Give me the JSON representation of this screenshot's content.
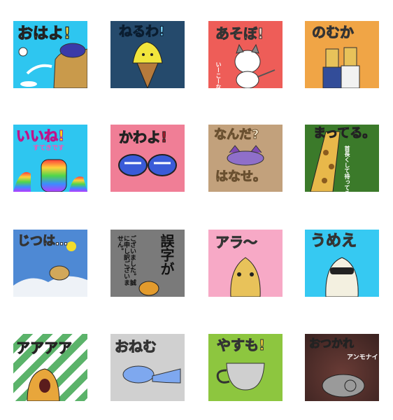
{
  "stickers": [
    {
      "id": "ohayo",
      "caption": "おはよ!",
      "extra": "♪",
      "bg": "#2ec6f0"
    },
    {
      "id": "neruwa",
      "caption": "ねるわ!",
      "extra": "",
      "bg": "#254a6c"
    },
    {
      "id": "asobo",
      "caption": "あそぼ!",
      "extra": "いーこーな",
      "bg": "#ee5d58"
    },
    {
      "id": "noseru",
      "caption": "のむか",
      "extra": "",
      "bg": "#f0a546"
    },
    {
      "id": "iine",
      "caption": "いいね!",
      "extra": "すてきです",
      "bg": "#2ec6f0"
    },
    {
      "id": "kawayo",
      "caption": "かわよ!",
      "extra": "",
      "bg": "#f07e96"
    },
    {
      "id": "nanda",
      "caption": "なんだ?",
      "caption2": "はなせ。",
      "extra": "",
      "bg": "#c2a17c"
    },
    {
      "id": "mattero",
      "caption": "まってる。",
      "extra": "首長くして待ってるよ。",
      "bg": "#3b7a2a"
    },
    {
      "id": "jitsuha",
      "caption": "じつは…",
      "extra": "",
      "bg": "#4e89d4"
    },
    {
      "id": "goji",
      "caption": "誤字が",
      "caption2": "ございました。誠に申し訳ございません。",
      "extra": "",
      "bg": "#7a7a7a"
    },
    {
      "id": "ara",
      "caption": "アラ〜",
      "extra": "",
      "bg": "#f7a9c6"
    },
    {
      "id": "umee",
      "caption": "うめえ",
      "extra": "",
      "bg": "#36c9f2"
    },
    {
      "id": "aaaa",
      "caption": "アアアア",
      "extra": "",
      "bg": "#ffffff"
    },
    {
      "id": "oneu",
      "caption": "おねむ",
      "extra": "",
      "bg": "#d0d0d0"
    },
    {
      "id": "yasumo",
      "caption": "やすも!",
      "extra": "",
      "bg": "#8dc63f"
    },
    {
      "id": "otsukare",
      "caption": "おつかれ",
      "extra": "アンモナイト",
      "bg": "#4a2e2c"
    }
  ]
}
